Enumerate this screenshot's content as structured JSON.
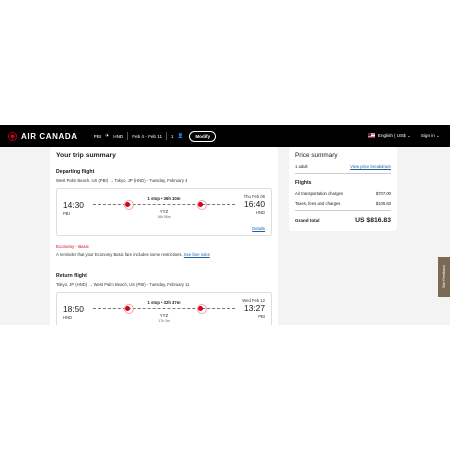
{
  "header": {
    "brand": "AIR CANADA",
    "origin": "PBI",
    "destination": "HND",
    "dates": "Feb 4 - Feb 11",
    "passengers": "1",
    "modify_label": "Modify",
    "language": "English | US$",
    "signin": "Sign in"
  },
  "summary": {
    "title": "Your trip summary",
    "departing": {
      "section_title": "Departing flight",
      "route": "West Palm Beach, US (PBI) → Tokyo, JP (HND) - Tuesday, February 4",
      "dep_time": "14:30",
      "dep_code": "PBI",
      "arr_date": "Thu Feb 06",
      "arr_time": "16:40",
      "arr_code": "HND",
      "stops": "1 stop • 36h 10m",
      "via": "YYZ",
      "layover": "16h 55m",
      "details": "Details",
      "fare_name": "Economy - Basic",
      "fare_note": "A reminder that your Economy Basic fare includes some restrictions.",
      "fare_link": "See fare rules"
    },
    "return": {
      "section_title": "Return flight",
      "route": "Tokyo, JP (HND) → West Palm Beach, US (PBI) - Tuesday, February 11",
      "dep_time": "18:50",
      "dep_code": "HND",
      "arr_date": "Wed Feb 12",
      "arr_time": "13:27",
      "arr_code": "PBI",
      "stops": "1 stop • 32h 37m",
      "via": "YYZ",
      "layover": "17h 3m"
    }
  },
  "price": {
    "title": "Price summary",
    "adults": "1 adult",
    "view_breakdown": "View price breakdown",
    "flights_label": "Flights",
    "air_label": "Air transportation charges",
    "air_value": "$707.00",
    "taxes_label": "Taxes, fees and charges",
    "taxes_value": "$109.83",
    "total_label": "Grand total",
    "total_value": "US $816.83"
  },
  "feedback_label": "Site Feedback",
  "colors": {
    "accent": "#d6001a",
    "link": "#1d5fa8",
    "header_bg": "#000000"
  }
}
